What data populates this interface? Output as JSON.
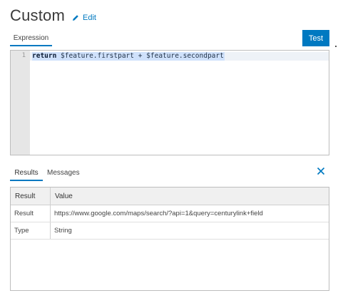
{
  "header": {
    "title": "Custom",
    "edit_label": "Edit"
  },
  "editor": {
    "tab_label": "Expression",
    "test_label": "Test",
    "line_number": "1",
    "code": {
      "keyword": "return",
      "rest": " $feature.firstpart + $feature.secondpart"
    }
  },
  "output": {
    "tabs": {
      "results": "Results",
      "messages": "Messages"
    },
    "table": {
      "headers": [
        "Result",
        "Value"
      ],
      "rows": [
        [
          "Result",
          "https://www.google.com/maps/search/?api=1&query=centurylink+field"
        ],
        [
          "Type",
          "String"
        ]
      ]
    }
  },
  "colors": {
    "accent": "#0079c1",
    "selection": "#cfe1fb",
    "gutter": "#e6e6e6"
  }
}
